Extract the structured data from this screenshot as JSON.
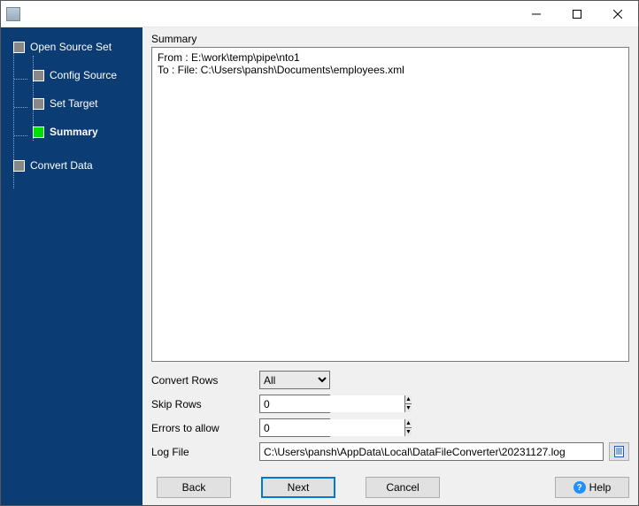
{
  "titlebar": {
    "title": ""
  },
  "sidebar": {
    "items": [
      {
        "label": "Open Source Set",
        "level": 1,
        "active": false
      },
      {
        "label": "Config Source",
        "level": 2,
        "active": false
      },
      {
        "label": "Set Target",
        "level": 2,
        "active": false
      },
      {
        "label": "Summary",
        "level": 2,
        "active": true
      },
      {
        "label": "Convert Data",
        "level": 1,
        "active": false
      }
    ]
  },
  "main": {
    "summary_label": "Summary",
    "summary_text": "From : E:\\work\\temp\\pipe\\nto1\nTo : File: C:\\Users\\pansh\\Documents\\employees.xml",
    "options": {
      "convert_rows_label": "Convert Rows",
      "convert_rows_value": "All",
      "skip_rows_label": "Skip Rows",
      "skip_rows_value": "0",
      "errors_label": "Errors to allow",
      "errors_value": "0",
      "logfile_label": "Log File",
      "logfile_value": "C:\\Users\\pansh\\AppData\\Local\\DataFileConverter\\20231127.log"
    }
  },
  "buttons": {
    "back": "Back",
    "next": "Next",
    "cancel": "Cancel",
    "help": "Help"
  }
}
